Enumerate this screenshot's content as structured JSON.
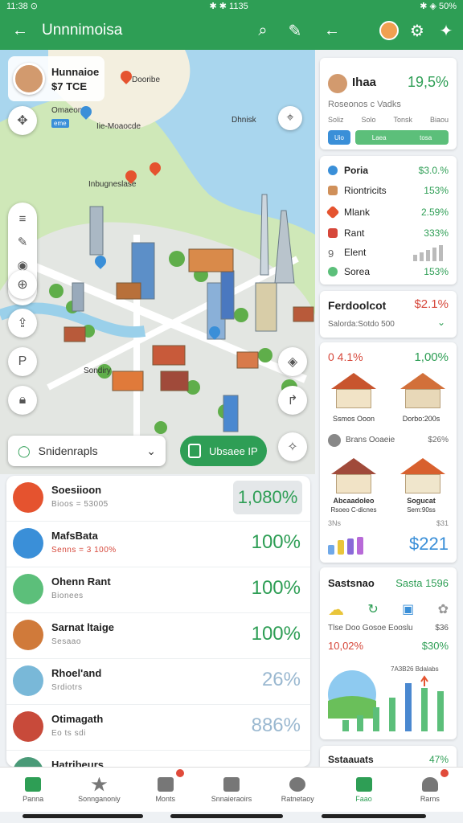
{
  "status": {
    "left": "11:38 ⊙",
    "center": "✱ ✱ 1135",
    "right": "✱ ◈ 50%"
  },
  "header": {
    "title": "Unnnimoisa"
  },
  "map": {
    "card_name_1": "Hunnaioe",
    "card_name_2": "$7 TCE",
    "labels": {
      "label1": "Dooribe",
      "label2": "Omaeon",
      "label3": "Iie-Moaocde",
      "label4": "Inbugneslase",
      "label5": "Dhnisk",
      "label6": "Sondiry"
    },
    "chip1": "eme",
    "search_label": "Snidenrapls",
    "go_label": "Ubsaee IP"
  },
  "list": [
    {
      "title": "Soesiioon",
      "sub": "Bioos = 53005",
      "pct": "1,080%",
      "icon_color": "#e5532f"
    },
    {
      "title": "MafsBata",
      "sub": "Senns = 3 100%",
      "pct": "100%",
      "icon_color": "#3a8fd8"
    },
    {
      "title": "Ohenn Rant",
      "sub": "Bionees",
      "pct": "100%",
      "icon_color": "#5cbf7a"
    },
    {
      "title": "Sarnat ltaige",
      "sub": "Sesaao",
      "pct": "100%",
      "icon_color": "#d07a3a"
    },
    {
      "title": "Rhoel'and",
      "sub": "Srdiotrs",
      "pct": "26%",
      "icon_color": "#79b8d8"
    },
    {
      "title": "Otimagath",
      "sub": "Eo ts sdi",
      "pct": "886%",
      "icon_color": "#c84a3a"
    },
    {
      "title": "Hatribeurs",
      "sub": "",
      "pct": "",
      "icon_color": "#4a9a78"
    }
  ],
  "panel_top": {
    "name": "Ihaa",
    "value": "19,5%",
    "sub": "Roseonos c Vadks",
    "labels": [
      "Soliz",
      "Solo",
      "Tonsk",
      "Biaou"
    ],
    "blue_label": "Uio",
    "green_labels": [
      "Laea",
      "tosa"
    ]
  },
  "panel_list": [
    {
      "label": "Poria",
      "value": "$3.0.%",
      "color": "#3a8fd8"
    },
    {
      "label": "Riontricits",
      "value": "153%",
      "color": "#d0905a"
    },
    {
      "label": "Mlank",
      "value": "2.59%",
      "color": "#e5532f"
    },
    {
      "label": "Rant",
      "value": "333%",
      "color": "#d6473a"
    },
    {
      "label": "Elent",
      "value": "",
      "color": "#666666"
    },
    {
      "label": "Sorea",
      "value": "153%",
      "color": "#5cbf7a"
    }
  ],
  "panel_three": {
    "title": "Ferdoolcot",
    "value": "$2.1%",
    "sub": "Salorda:Sotdo 500"
  },
  "panel_four": {
    "h1": "0 4.1%",
    "h2": "1,00%",
    "cap1": "Ssmos Ooon",
    "cap2": "Dorbo:200s",
    "mid_label": "Brans Ooaeie",
    "mid_value": "$26%",
    "cap3": "Abcaadoleo",
    "cap3b": "Rsoeo C-dicnes",
    "cap4": "Sogucat",
    "cap4b": "Sem:90ss",
    "bottom_left": "3Ns",
    "bottom_value": "$221",
    "bottom_small": "$31"
  },
  "panel_five": {
    "title": "Sastsnao",
    "value": "Sasta 1596",
    "row1_left": "Tlse Doo Gosoe Eooslu",
    "row1_right": "$36",
    "row2_left": "10,02%",
    "row2_right": "$30%",
    "chart_caption": "7A3B26 Bdalabs"
  },
  "panel_six": {
    "title": "Sstaauats",
    "value": "47%"
  },
  "tabs": [
    {
      "label": "Panna",
      "active": false,
      "badge": false
    },
    {
      "label": "Sonnganoniy",
      "active": false,
      "badge": false
    },
    {
      "label": "Monts",
      "active": false,
      "badge": true
    },
    {
      "label": "Snnaieraoirs",
      "active": false,
      "badge": false
    },
    {
      "label": "Ratnetaoy",
      "active": false,
      "badge": false
    },
    {
      "label": "Faao",
      "active": true,
      "badge": false
    },
    {
      "label": "Rarns",
      "active": false,
      "badge": true
    }
  ],
  "colors": {
    "primary": "#2e9e55",
    "danger": "#d6473a",
    "accent": "#3a8fd8"
  }
}
